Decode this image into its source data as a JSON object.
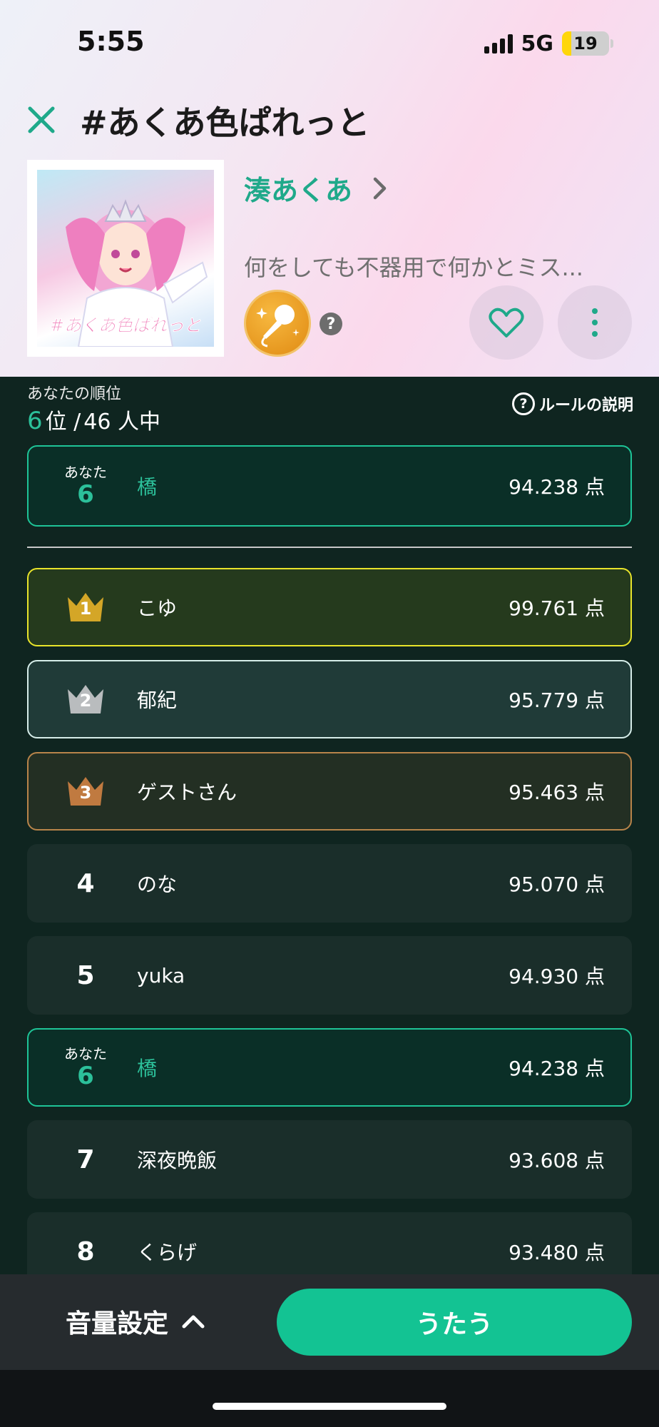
{
  "status_bar": {
    "time": "5:55",
    "network": "5G",
    "battery": "19",
    "battery_percent": 19
  },
  "song": {
    "title": "#あくあ色ぱれっと",
    "artist": "湊あくあ",
    "description": "何をしても不器用で何かとミス...",
    "help": "?"
  },
  "ranking": {
    "label": "あなたの順位",
    "my_rank": "6",
    "rank_suffix": "位 /",
    "total": "46 人中",
    "rules_label": "ルールの説明",
    "rules_icon": "?"
  },
  "my_row": {
    "tag": "あなた",
    "rank": "6",
    "name": "橋",
    "score": "94.238 点"
  },
  "leaderboard": [
    {
      "rank": "1",
      "name": "こゆ",
      "score": "99.761 点",
      "medal": "gold"
    },
    {
      "rank": "2",
      "name": "郁紀",
      "score": "95.779 点",
      "medal": "silver"
    },
    {
      "rank": "3",
      "name": "ゲストさん",
      "score": "95.463 点",
      "medal": "bronze"
    },
    {
      "rank": "4",
      "name": "のな",
      "score": "95.070 点"
    },
    {
      "rank": "5",
      "name": "yuka",
      "score": "94.930 点"
    },
    {
      "rank": "6",
      "name": "橋",
      "score": "94.238 点",
      "tag": "あなた"
    },
    {
      "rank": "7",
      "name": "深夜晩飯",
      "score": "93.608 点"
    },
    {
      "rank": "8",
      "name": "くらげ",
      "score": "93.480 点"
    }
  ],
  "bottom": {
    "volume_label": "音量設定",
    "sing_label": "うたう"
  },
  "colors": {
    "accent": "#13c393",
    "gold": "#e8e42a",
    "silver": "#d6ede9",
    "bronze": "#b8844a",
    "background": "#0f2520"
  },
  "icons": [
    "close-icon",
    "chevron-right-icon",
    "microphone-icon",
    "heart-icon",
    "more-vertical-icon",
    "question-icon",
    "crown-icon",
    "chevron-up-icon"
  ]
}
